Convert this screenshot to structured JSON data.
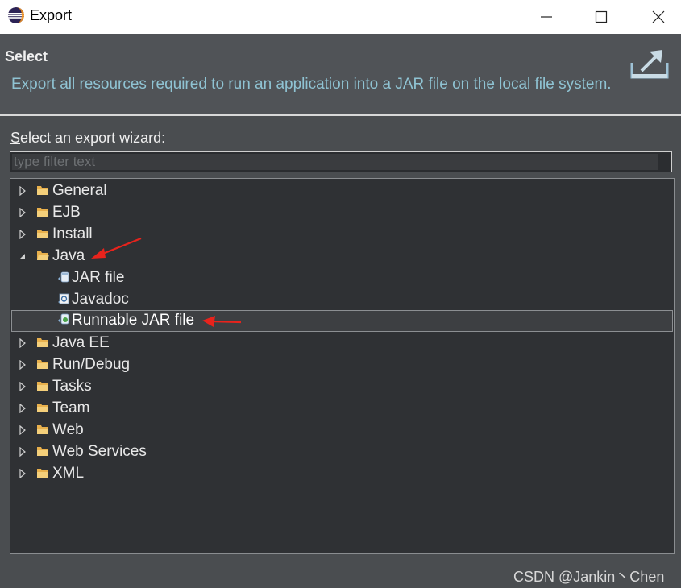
{
  "window": {
    "title": "Export",
    "minimize_icon": "minimize-icon",
    "maximize_icon": "maximize-icon",
    "close_icon": "close-icon"
  },
  "header": {
    "title": "Select",
    "description": "Export all resources required to run an application into a JAR file on the local file system.",
    "icon": "export-wizard-icon"
  },
  "wizard": {
    "label_mnemonic": "S",
    "label_rest": "elect an export wizard:",
    "filter_placeholder": "type filter text"
  },
  "tree": [
    {
      "label": "General",
      "type": "folder",
      "expanded": false,
      "level": 0
    },
    {
      "label": "EJB",
      "type": "folder",
      "expanded": false,
      "level": 0
    },
    {
      "label": "Install",
      "type": "folder",
      "expanded": false,
      "level": 0
    },
    {
      "label": "Java",
      "type": "folder",
      "expanded": true,
      "level": 0
    },
    {
      "label": "JAR file",
      "type": "jar",
      "level": 1
    },
    {
      "label": "Javadoc",
      "type": "javadoc",
      "level": 1
    },
    {
      "label": "Runnable JAR file",
      "type": "runnable-jar",
      "level": 1,
      "selected": true
    },
    {
      "label": "Java EE",
      "type": "folder",
      "expanded": false,
      "level": 0
    },
    {
      "label": "Run/Debug",
      "type": "folder",
      "expanded": false,
      "level": 0
    },
    {
      "label": "Tasks",
      "type": "folder",
      "expanded": false,
      "level": 0
    },
    {
      "label": "Team",
      "type": "folder",
      "expanded": false,
      "level": 0
    },
    {
      "label": "Web",
      "type": "folder",
      "expanded": false,
      "level": 0
    },
    {
      "label": "Web Services",
      "type": "folder",
      "expanded": false,
      "level": 0
    },
    {
      "label": "XML",
      "type": "folder",
      "expanded": false,
      "level": 0
    }
  ],
  "watermark": "CSDN @Jankin丶Chen",
  "colors": {
    "annotation_arrow": "#e8231c",
    "description_text": "#8fc3d3",
    "folder": "#e8b04c"
  }
}
